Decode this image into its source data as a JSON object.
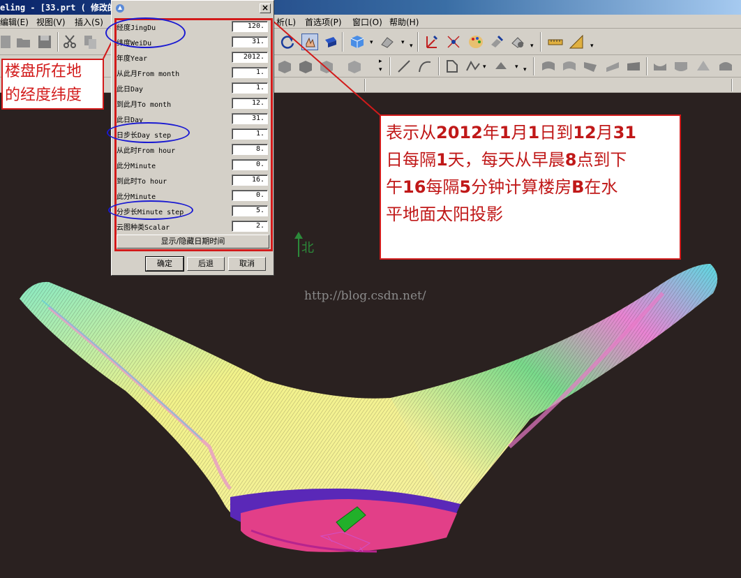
{
  "window": {
    "title": "eling - [33.prt ( 修改的"
  },
  "menubar": {
    "items": [
      "编辑(E)",
      "视图(V)",
      "插入(S)",
      "析(L)",
      "首选项(P)",
      "窗口(O)",
      "帮助(H)"
    ]
  },
  "dialog": {
    "fields": [
      {
        "label": "经度JingDu",
        "value": "120."
      },
      {
        "label": "纬度WeiDu",
        "value": "31."
      },
      {
        "label": "年度Year",
        "value": "2012."
      },
      {
        "label": "从此月From month",
        "value": "1."
      },
      {
        "label": "此日Day",
        "value": "1."
      },
      {
        "label": "到此月To month",
        "value": "12."
      },
      {
        "label": "此日Day",
        "value": "31."
      },
      {
        "label": "日步长Day step",
        "value": "1."
      },
      {
        "label": "从此时From hour",
        "value": "8."
      },
      {
        "label": "此分Minute",
        "value": "0."
      },
      {
        "label": "到此时To hour",
        "value": "16."
      },
      {
        "label": "此分Minute",
        "value": "0."
      },
      {
        "label": "分步长Minute step",
        "value": "5."
      },
      {
        "label": "云图种类Scalar",
        "value": "2."
      }
    ],
    "show_hide_label": "显示/隐藏日期时间",
    "ok_label": "确定",
    "back_label": "后退",
    "cancel_label": "取消",
    "close_label": "×"
  },
  "annotations": {
    "left": {
      "line1": "楼盘所在地",
      "line2": "的经度纬度"
    },
    "right": {
      "line1": [
        "表示从",
        "2012",
        "年",
        "1",
        "月",
        "1",
        "日到",
        "12",
        "月",
        "31"
      ],
      "line2": [
        "日每隔",
        "1",
        "天，每天从早晨",
        "8",
        "点到下"
      ],
      "line3": [
        "午",
        "16",
        "每隔",
        "5",
        "分钟计算楼房",
        "B",
        "在水"
      ],
      "line4": [
        "平地面太阳投影"
      ]
    },
    "colors": {
      "frame": "#d21a1a",
      "ellipse": "#1a1ad2"
    }
  },
  "viewport": {
    "north_label": "北",
    "watermark": "http://blog.csdn.net/",
    "background": "#2a2120"
  }
}
